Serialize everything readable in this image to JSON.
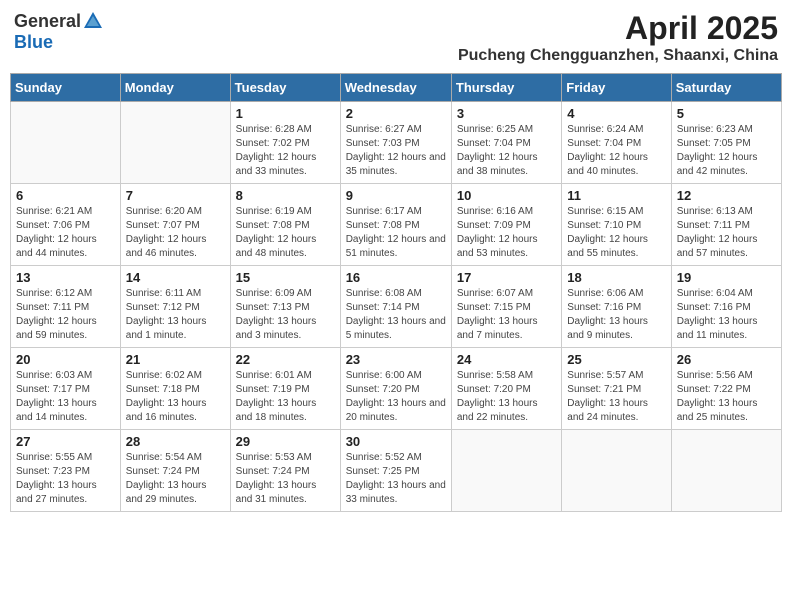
{
  "header": {
    "logo_general": "General",
    "logo_blue": "Blue",
    "month_title": "April 2025",
    "location": "Pucheng Chengguanzhen, Shaanxi, China"
  },
  "days_of_week": [
    "Sunday",
    "Monday",
    "Tuesday",
    "Wednesday",
    "Thursday",
    "Friday",
    "Saturday"
  ],
  "weeks": [
    [
      {
        "day": "",
        "info": ""
      },
      {
        "day": "",
        "info": ""
      },
      {
        "day": "1",
        "info": "Sunrise: 6:28 AM\nSunset: 7:02 PM\nDaylight: 12 hours and 33 minutes."
      },
      {
        "day": "2",
        "info": "Sunrise: 6:27 AM\nSunset: 7:03 PM\nDaylight: 12 hours and 35 minutes."
      },
      {
        "day": "3",
        "info": "Sunrise: 6:25 AM\nSunset: 7:04 PM\nDaylight: 12 hours and 38 minutes."
      },
      {
        "day": "4",
        "info": "Sunrise: 6:24 AM\nSunset: 7:04 PM\nDaylight: 12 hours and 40 minutes."
      },
      {
        "day": "5",
        "info": "Sunrise: 6:23 AM\nSunset: 7:05 PM\nDaylight: 12 hours and 42 minutes."
      }
    ],
    [
      {
        "day": "6",
        "info": "Sunrise: 6:21 AM\nSunset: 7:06 PM\nDaylight: 12 hours and 44 minutes."
      },
      {
        "day": "7",
        "info": "Sunrise: 6:20 AM\nSunset: 7:07 PM\nDaylight: 12 hours and 46 minutes."
      },
      {
        "day": "8",
        "info": "Sunrise: 6:19 AM\nSunset: 7:08 PM\nDaylight: 12 hours and 48 minutes."
      },
      {
        "day": "9",
        "info": "Sunrise: 6:17 AM\nSunset: 7:08 PM\nDaylight: 12 hours and 51 minutes."
      },
      {
        "day": "10",
        "info": "Sunrise: 6:16 AM\nSunset: 7:09 PM\nDaylight: 12 hours and 53 minutes."
      },
      {
        "day": "11",
        "info": "Sunrise: 6:15 AM\nSunset: 7:10 PM\nDaylight: 12 hours and 55 minutes."
      },
      {
        "day": "12",
        "info": "Sunrise: 6:13 AM\nSunset: 7:11 PM\nDaylight: 12 hours and 57 minutes."
      }
    ],
    [
      {
        "day": "13",
        "info": "Sunrise: 6:12 AM\nSunset: 7:11 PM\nDaylight: 12 hours and 59 minutes."
      },
      {
        "day": "14",
        "info": "Sunrise: 6:11 AM\nSunset: 7:12 PM\nDaylight: 13 hours and 1 minute."
      },
      {
        "day": "15",
        "info": "Sunrise: 6:09 AM\nSunset: 7:13 PM\nDaylight: 13 hours and 3 minutes."
      },
      {
        "day": "16",
        "info": "Sunrise: 6:08 AM\nSunset: 7:14 PM\nDaylight: 13 hours and 5 minutes."
      },
      {
        "day": "17",
        "info": "Sunrise: 6:07 AM\nSunset: 7:15 PM\nDaylight: 13 hours and 7 minutes."
      },
      {
        "day": "18",
        "info": "Sunrise: 6:06 AM\nSunset: 7:16 PM\nDaylight: 13 hours and 9 minutes."
      },
      {
        "day": "19",
        "info": "Sunrise: 6:04 AM\nSunset: 7:16 PM\nDaylight: 13 hours and 11 minutes."
      }
    ],
    [
      {
        "day": "20",
        "info": "Sunrise: 6:03 AM\nSunset: 7:17 PM\nDaylight: 13 hours and 14 minutes."
      },
      {
        "day": "21",
        "info": "Sunrise: 6:02 AM\nSunset: 7:18 PM\nDaylight: 13 hours and 16 minutes."
      },
      {
        "day": "22",
        "info": "Sunrise: 6:01 AM\nSunset: 7:19 PM\nDaylight: 13 hours and 18 minutes."
      },
      {
        "day": "23",
        "info": "Sunrise: 6:00 AM\nSunset: 7:20 PM\nDaylight: 13 hours and 20 minutes."
      },
      {
        "day": "24",
        "info": "Sunrise: 5:58 AM\nSunset: 7:20 PM\nDaylight: 13 hours and 22 minutes."
      },
      {
        "day": "25",
        "info": "Sunrise: 5:57 AM\nSunset: 7:21 PM\nDaylight: 13 hours and 24 minutes."
      },
      {
        "day": "26",
        "info": "Sunrise: 5:56 AM\nSunset: 7:22 PM\nDaylight: 13 hours and 25 minutes."
      }
    ],
    [
      {
        "day": "27",
        "info": "Sunrise: 5:55 AM\nSunset: 7:23 PM\nDaylight: 13 hours and 27 minutes."
      },
      {
        "day": "28",
        "info": "Sunrise: 5:54 AM\nSunset: 7:24 PM\nDaylight: 13 hours and 29 minutes."
      },
      {
        "day": "29",
        "info": "Sunrise: 5:53 AM\nSunset: 7:24 PM\nDaylight: 13 hours and 31 minutes."
      },
      {
        "day": "30",
        "info": "Sunrise: 5:52 AM\nSunset: 7:25 PM\nDaylight: 13 hours and 33 minutes."
      },
      {
        "day": "",
        "info": ""
      },
      {
        "day": "",
        "info": ""
      },
      {
        "day": "",
        "info": ""
      }
    ]
  ]
}
